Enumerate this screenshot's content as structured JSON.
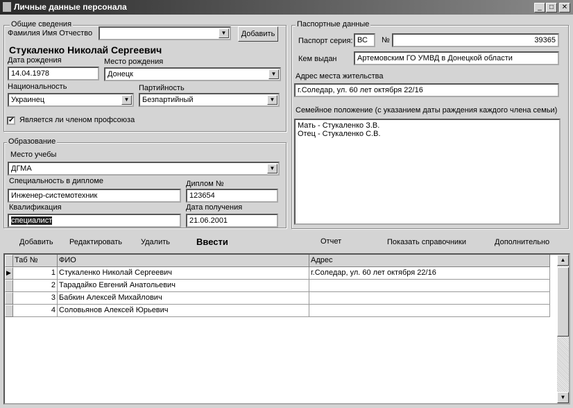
{
  "window": {
    "title": "Личные данные персонала",
    "min": "_",
    "max": "□",
    "close": "✕"
  },
  "general": {
    "legend": "Общие сведения",
    "fio_label": "Фамилия Имя Отчество",
    "fio_value": "",
    "add_button": "Добавить",
    "full_name": "Стукаленко Николай Сергеевич",
    "birth_date_label": "Дата рождения",
    "birth_date": "14.04.1978",
    "birth_place_label": "Место рождения",
    "birth_place": "Донецк",
    "nationality_label": "Национальность",
    "nationality": "Украинец",
    "party_label": "Партийность",
    "party": "Безпартийный",
    "union_label": "Является ли членом профсоюза",
    "union_checked": true
  },
  "education": {
    "legend": "Образование",
    "school_label": "Место учебы",
    "school": "ДГМА",
    "specialty_label": "Специальность в дипломе",
    "specialty": "Инженер-системотехник",
    "diploma_label": "Диплом №",
    "diploma": "123654",
    "qualification_label": "Квалификация",
    "qualification": "специалист",
    "date_label": "Дата получения",
    "date": "21.06.2001"
  },
  "passport": {
    "legend": "Паспортные данные",
    "series_label": "Паспорт серия:",
    "series": "ВС",
    "number_label": "№",
    "number": "39365",
    "issued_label": "Кем выдан",
    "issued": "Артемовским ГО УМВД в Донецкой области",
    "address_label": "Адрес места жительства",
    "address": "г.Соледар, ул. 60 лет октября 22/16",
    "family_label": "Семейное положение (с указанием даты раждения каждого члена семьи)",
    "family": [
      "Мать - Стукаленко З.В.",
      "Отец - Стукаленко С.В."
    ]
  },
  "toolbar": {
    "add": "Добавить",
    "edit": "Редактировать",
    "delete": "Удалить",
    "enter": "Ввести",
    "report": "Отчет",
    "refs": "Показать справочники",
    "more": "Дополнительно"
  },
  "grid": {
    "headers": [
      "Таб №",
      "ФИО",
      "Адрес"
    ],
    "rows": [
      {
        "n": "1",
        "fio": "Стукаленко Николай Сергеевич",
        "addr": "г.Соледар, ул. 60 лет октября 22/16"
      },
      {
        "n": "2",
        "fio": "Тарадайко Евгений Анатольевич",
        "addr": ""
      },
      {
        "n": "3",
        "fio": "Бабкин Алексей Михайлович",
        "addr": ""
      },
      {
        "n": "4",
        "fio": "Соловьянов Алексей Юрьевич",
        "addr": ""
      }
    ]
  }
}
